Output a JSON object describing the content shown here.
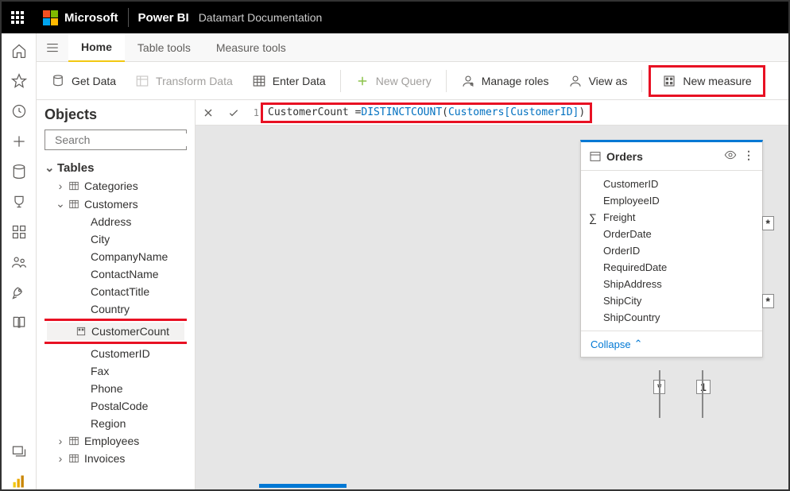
{
  "header": {
    "brand": "Microsoft",
    "product": "Power BI",
    "doc_title": "Datamart Documentation"
  },
  "ribbon_tabs": [
    "Home",
    "Table tools",
    "Measure tools"
  ],
  "active_tab": "Home",
  "toolbar": {
    "get_data": "Get Data",
    "transform_data": "Transform Data",
    "enter_data": "Enter Data",
    "new_query": "New Query",
    "manage_roles": "Manage roles",
    "view_as": "View as",
    "new_measure": "New measure"
  },
  "objects": {
    "title": "Objects",
    "search_placeholder": "Search",
    "tables_label": "Tables",
    "tables": [
      {
        "name": "Categories",
        "expanded": false
      },
      {
        "name": "Customers",
        "expanded": true,
        "fields": [
          "Address",
          "City",
          "CompanyName",
          "ContactName",
          "ContactTitle",
          "Country",
          "CustomerCount",
          "CustomerID",
          "Fax",
          "Phone",
          "PostalCode",
          "Region"
        ],
        "measure_field": "CustomerCount"
      },
      {
        "name": "Employees",
        "expanded": false
      },
      {
        "name": "Invoices",
        "expanded": false
      }
    ]
  },
  "formula": {
    "line_number": "1",
    "text_name": "CustomerCount = ",
    "text_func": "DISTINCTCOUNT",
    "text_ref": "Customers[CustomerID]"
  },
  "orders_card": {
    "title": "Orders",
    "fields": [
      {
        "name": "CustomerID",
        "sigma": false
      },
      {
        "name": "EmployeeID",
        "sigma": false
      },
      {
        "name": "Freight",
        "sigma": true
      },
      {
        "name": "OrderDate",
        "sigma": false
      },
      {
        "name": "OrderID",
        "sigma": false
      },
      {
        "name": "RequiredDate",
        "sigma": false
      },
      {
        "name": "ShipAddress",
        "sigma": false
      },
      {
        "name": "ShipCity",
        "sigma": false
      },
      {
        "name": "ShipCountry",
        "sigma": false
      }
    ],
    "collapse_label": "Collapse"
  },
  "relationship_markers": {
    "star": "*",
    "one": "1"
  }
}
